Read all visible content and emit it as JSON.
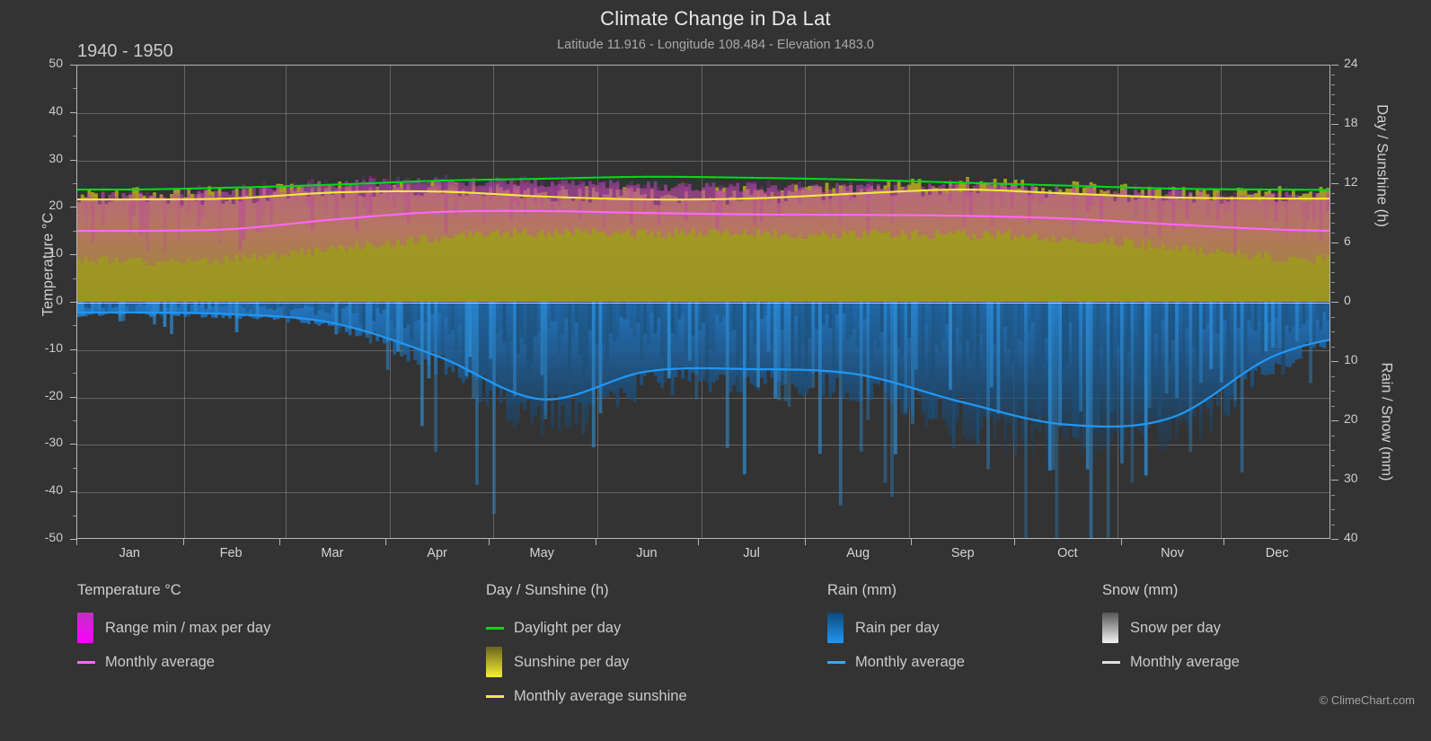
{
  "header": {
    "title": "Climate Change in Da Lat",
    "subtitle": "Latitude 11.916 - Longitude 108.484 - Elevation 1483.0",
    "period": "1940 - 1950"
  },
  "branding": {
    "logo_text": "ClimeChart.com",
    "copyright": "© ClimeChart.com",
    "logo_ring_color": "#d926d9",
    "logo_ball_color": "#dcc820",
    "logo_text_color": "#2196f3"
  },
  "axes": {
    "left_label": "Temperature °C",
    "left_ticks": [
      "50",
      "40",
      "30",
      "20",
      "10",
      "0",
      "-10",
      "-20",
      "-30",
      "-40",
      "-50"
    ],
    "right_top_label": "Day / Sunshine (h)",
    "right_top_ticks": [
      "24",
      "18",
      "12",
      "6",
      "0"
    ],
    "right_bottom_label": "Rain / Snow (mm)",
    "right_bottom_ticks": [
      "0",
      "10",
      "20",
      "30",
      "40"
    ],
    "x_ticks": [
      "Jan",
      "Feb",
      "Mar",
      "Apr",
      "May",
      "Jun",
      "Jul",
      "Aug",
      "Sep",
      "Oct",
      "Nov",
      "Dec"
    ]
  },
  "legend": {
    "groups": [
      {
        "title": "Temperature °C",
        "items": [
          {
            "label": "Range min / max per day",
            "marker": "swatch",
            "color": "#ff00ff",
            "color2": "#c030c0"
          },
          {
            "label": "Monthly average",
            "marker": "line",
            "color": "#ff66ff"
          }
        ]
      },
      {
        "title": "Day / Sunshine (h)",
        "items": [
          {
            "label": "Daylight per day",
            "marker": "line",
            "color": "#00d820"
          },
          {
            "label": "Sunshine per day",
            "marker": "swatch",
            "color": "#f5ee3c",
            "color2": "#6b6418"
          },
          {
            "label": "Monthly average sunshine",
            "marker": "line",
            "color": "#f2ea3a"
          }
        ]
      },
      {
        "title": "Rain (mm)",
        "items": [
          {
            "label": "Rain per day",
            "marker": "swatch",
            "color": "#2196f3",
            "color2": "#0d4a7a"
          },
          {
            "label": "Monthly average",
            "marker": "line",
            "color": "#3ba7f0"
          }
        ]
      },
      {
        "title": "Snow (mm)",
        "items": [
          {
            "label": "Snow per day",
            "marker": "swatch",
            "color": "#f2f2f2",
            "color2": "#555555"
          },
          {
            "label": "Monthly average",
            "marker": "line",
            "color": "#e0e0e0"
          }
        ]
      }
    ]
  },
  "chart_data": {
    "type": "area",
    "title": "Climate Change in Da Lat",
    "subtitle": "Latitude 11.916 - Longitude 108.484 - Elevation 1483.0",
    "period": "1940 - 1950",
    "xlabel": "",
    "ylabel": "Temperature °C",
    "ylim": [
      -50,
      50
    ],
    "y2_top_label": "Day / Sunshine (h)",
    "y2_top_lim": [
      0,
      24
    ],
    "y2_bottom_label": "Rain / Snow (mm)",
    "y2_bottom_lim": [
      0,
      40
    ],
    "grid": true,
    "legend_position": "bottom",
    "categories": [
      "Jan",
      "Feb",
      "Mar",
      "Apr",
      "May",
      "Jun",
      "Jul",
      "Aug",
      "Sep",
      "Oct",
      "Nov",
      "Dec"
    ],
    "series": [
      {
        "name": "Monthly average temperature",
        "unit": "°C",
        "color": "#ff66ff",
        "axis": "left",
        "values": [
          15.0,
          15.4,
          17.4,
          19.0,
          19.2,
          18.8,
          18.5,
          18.4,
          18.2,
          17.6,
          16.4,
          15.3
        ]
      },
      {
        "name": "Temperature range max per day",
        "unit": "°C",
        "color": "#c030c0",
        "axis": "left",
        "values": [
          22.2,
          23.2,
          24.8,
          25.4,
          25.2,
          24.6,
          24.2,
          24.0,
          24.0,
          23.6,
          22.8,
          22.2
        ]
      },
      {
        "name": "Temperature range min per day",
        "unit": "°C",
        "color": "#c030c0",
        "axis": "left",
        "values": [
          8.6,
          9.0,
          11.2,
          13.6,
          14.6,
          14.6,
          14.4,
          14.4,
          14.2,
          13.6,
          11.6,
          9.4
        ]
      },
      {
        "name": "Daylight per day",
        "unit": "h",
        "color": "#00d820",
        "axis": "right_top",
        "values": [
          11.4,
          11.6,
          11.9,
          12.3,
          12.5,
          12.7,
          12.6,
          12.4,
          12.1,
          11.8,
          11.5,
          11.4
        ]
      },
      {
        "name": "Monthly average sunshine",
        "unit": "h",
        "color": "#f2ea3a",
        "axis": "right_top",
        "values": [
          10.4,
          10.5,
          11.1,
          11.2,
          10.7,
          10.4,
          10.5,
          11.0,
          11.4,
          11.0,
          10.6,
          10.5
        ]
      },
      {
        "name": "Monthly average rain",
        "unit": "mm",
        "color": "#3ba7f0",
        "axis": "right_bottom",
        "values": [
          1.8,
          2.1,
          3.6,
          9.2,
          16.5,
          11.8,
          11.4,
          12.3,
          17.0,
          20.8,
          19.6,
          9.0
        ]
      }
    ],
    "annotations": [
      "Daily rain bars shown downward below the zero line",
      "Daily sunshine bars shown in olive/yellow above the zero line",
      "Daily temperature min/max range shown as magenta band"
    ]
  }
}
